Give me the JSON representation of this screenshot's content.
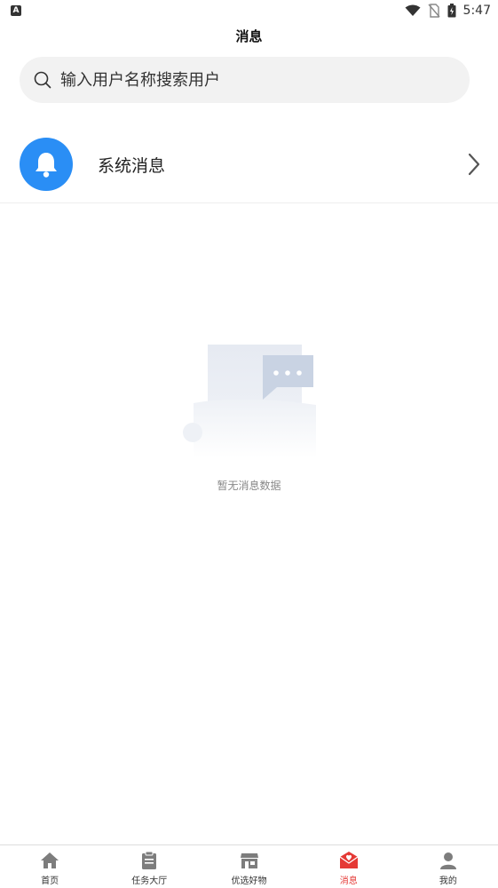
{
  "status_bar": {
    "left_icon": "A",
    "time": "5:47",
    "icons": [
      "wifi-icon",
      "no-sim-icon",
      "battery-icon"
    ]
  },
  "header": {
    "title": "消息"
  },
  "search": {
    "placeholder": "输入用户名称搜索用户",
    "value": ""
  },
  "system_message": {
    "label": "系统消息",
    "icon": "bell-icon",
    "accent_color": "#2a8ef5"
  },
  "empty_state": {
    "text": "暂无消息数据",
    "icon": "empty-message-illustration"
  },
  "bottom_nav": {
    "active_color": "#e53935",
    "items": [
      {
        "label": "首页",
        "icon": "home-icon",
        "active": false
      },
      {
        "label": "任务大厅",
        "icon": "clipboard-icon",
        "active": false
      },
      {
        "label": "优选好物",
        "icon": "store-icon",
        "active": false
      },
      {
        "label": "消息",
        "icon": "mail-heart-icon",
        "active": true
      },
      {
        "label": "我的",
        "icon": "user-icon",
        "active": false
      }
    ]
  }
}
